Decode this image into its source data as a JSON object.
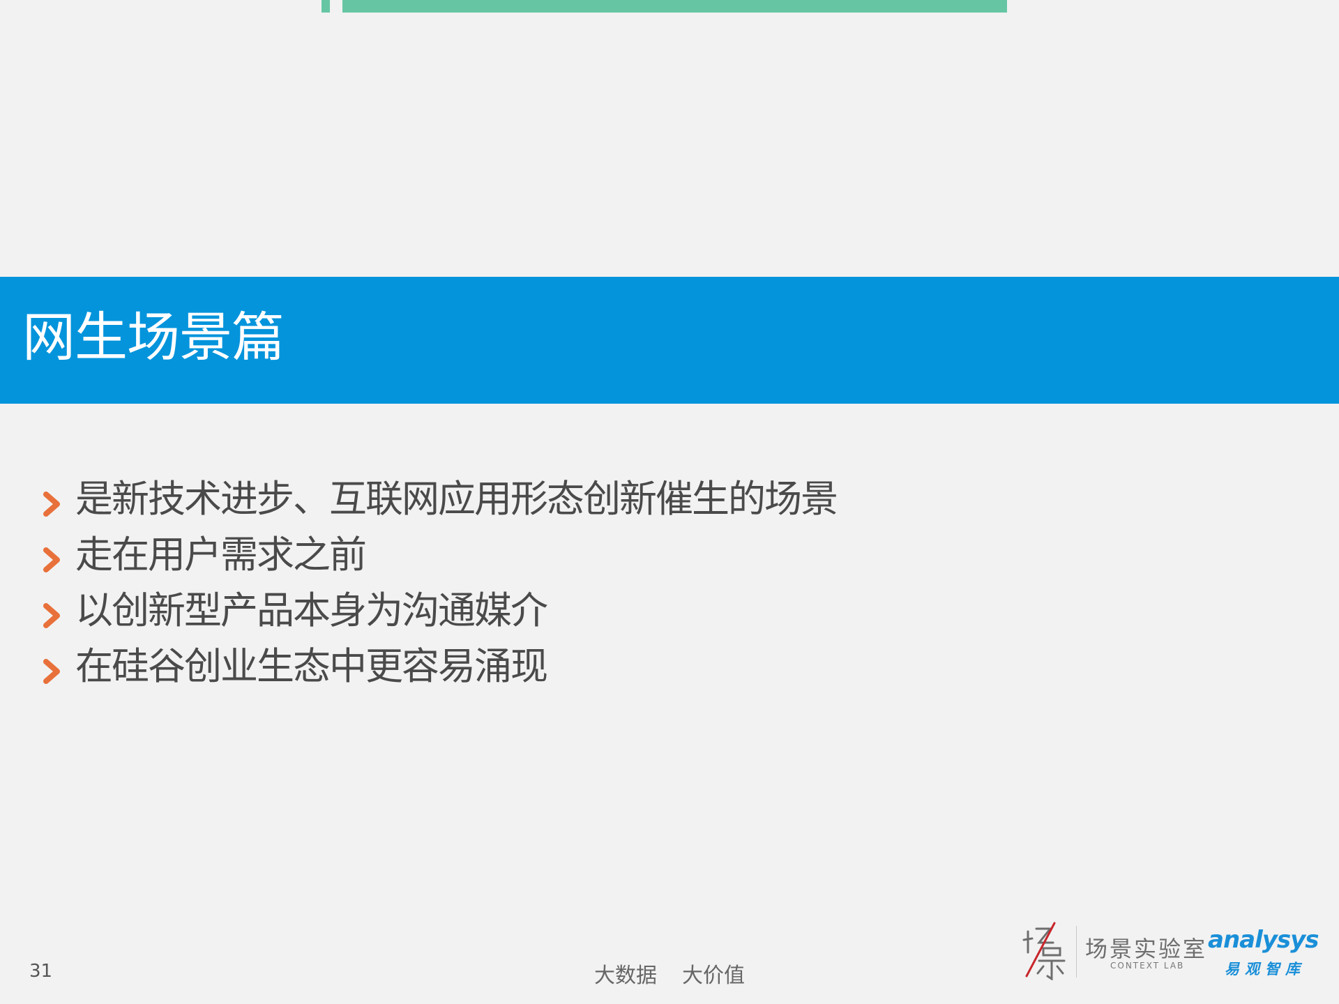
{
  "section": {
    "title": "网生场景篇"
  },
  "bullets": [
    {
      "text": "是新技术进步、互联网应用形态创新催生的场景"
    },
    {
      "text": "走在用户需求之前"
    },
    {
      "text": "以创新型产品本身为沟通媒介"
    },
    {
      "text": "在硅谷创业生态中更容易涌现"
    }
  ],
  "footer": {
    "page_number": "31",
    "slogan_left": "大数据",
    "slogan_right": "大价值"
  },
  "logos": {
    "context_lab_cn": "场景实验室",
    "context_lab_en": "CONTEXT LAB",
    "analysys_en": "analysys",
    "analysys_cn": "易观智库"
  },
  "colors": {
    "band": "#0394dc",
    "accent_green": "#66c6a3",
    "bullet_marker": "#e8703a",
    "background": "#f2f2f2"
  },
  "icons": {
    "bullet": "chevron-right-icon",
    "context_lab_mark": "context-lab-logo-icon"
  }
}
